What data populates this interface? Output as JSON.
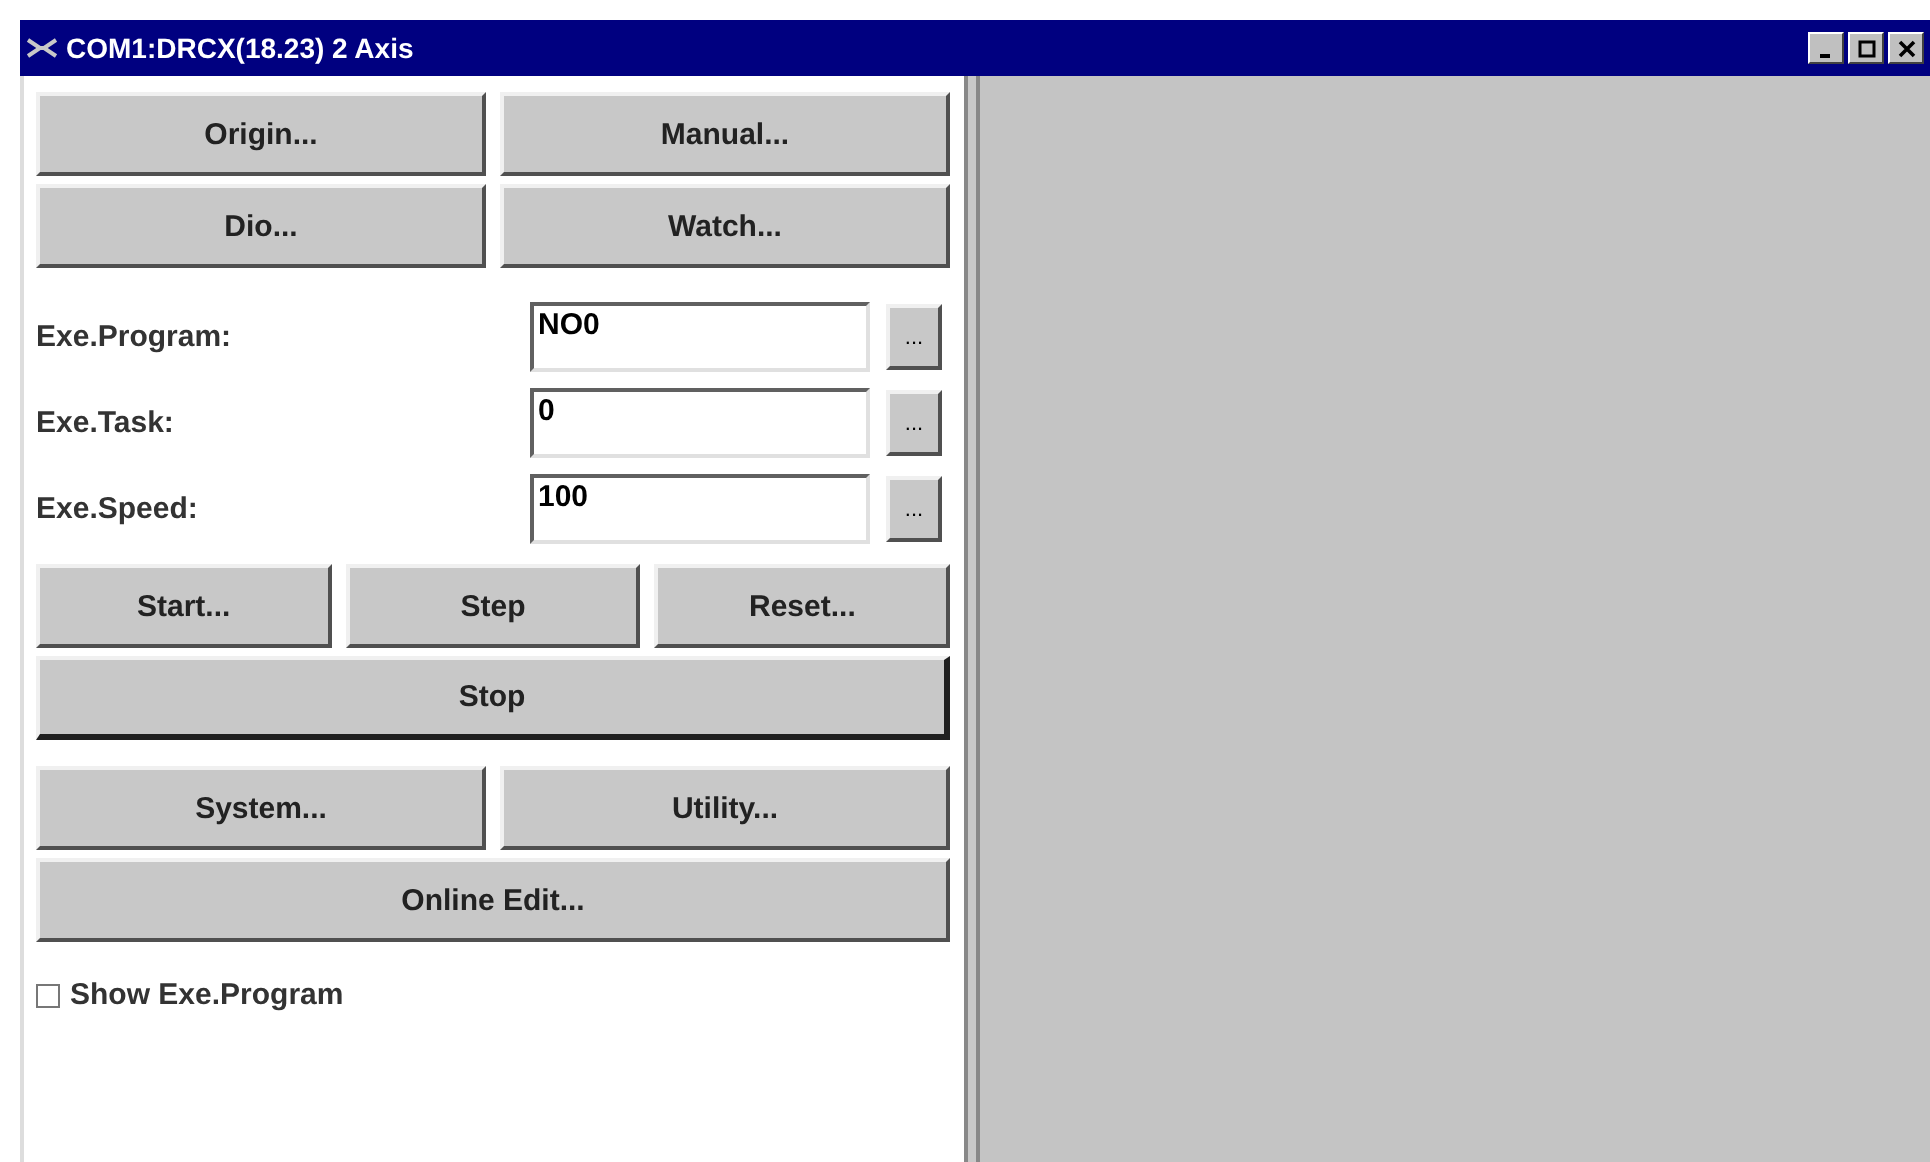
{
  "window": {
    "title": "COM1:DRCX(18.23) 2 Axis",
    "controls": [
      {
        "kind": "minimize"
      },
      {
        "kind": "maximize"
      },
      {
        "kind": "close"
      }
    ]
  },
  "top_buttons": [
    [
      "Origin...",
      "Manual..."
    ],
    [
      "Dio...",
      "Watch..."
    ]
  ],
  "fields": [
    {
      "label": "Exe.Program:",
      "value": "NO0",
      "button": "..."
    },
    {
      "label": "Exe.Task:",
      "value": "0",
      "button": "..."
    },
    {
      "label": "Exe.Speed:",
      "value": "100",
      "button": "..."
    }
  ],
  "run_buttons": [
    "Start...",
    "Step",
    "Reset..."
  ],
  "stop_button": "Stop",
  "bottom_buttons": [
    [
      "System...",
      "Utility..."
    ],
    [
      "Online Edit..."
    ]
  ],
  "checkbox": {
    "label": "Show Exe.Program",
    "checked": false
  }
}
